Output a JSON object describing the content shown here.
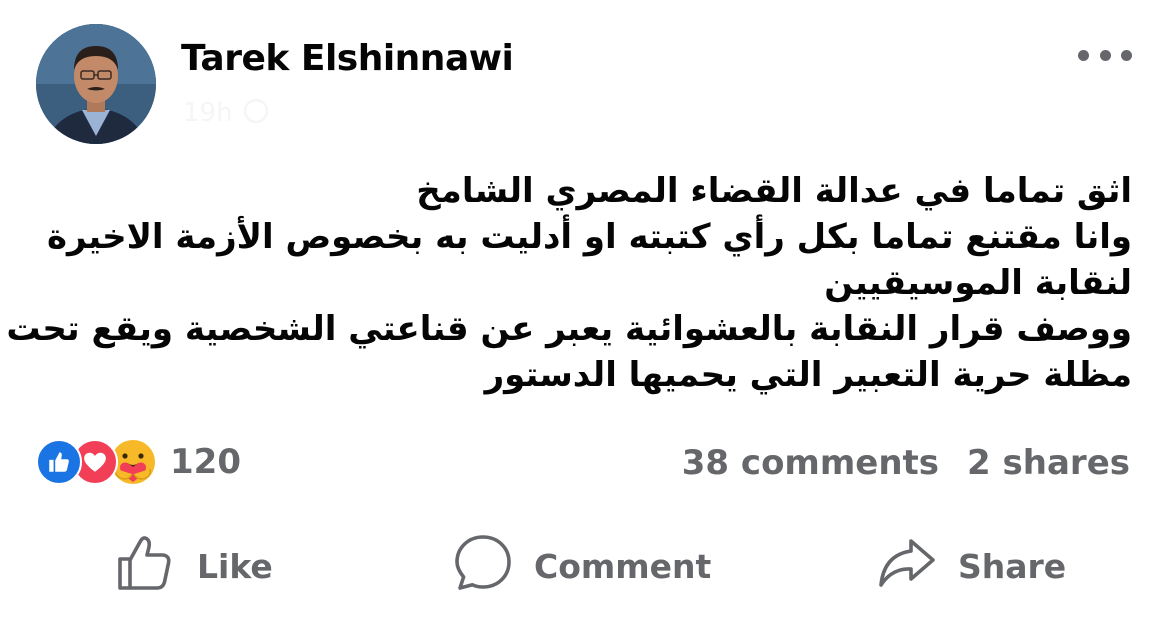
{
  "post": {
    "author": "Tarek Elshinnawi",
    "time": "19h",
    "text_lines": [
      "اثق  تماما في عدالة القضاء المصري الشامخ",
      "وانا مقتنع تماما بكل رأي كتبته او أدليت به بخصوص الأزمة الاخيرة",
      "لنقابة الموسيقيين",
      "ووصف قرار النقابة بالعشوائية يعبر عن قناعتي الشخصية ويقع تحت",
      "مظلة حرية التعبير  التي يحميها  الدستور"
    ]
  },
  "reactions": {
    "types": [
      "like-icon",
      "love-icon",
      "care-icon"
    ],
    "count": "120"
  },
  "engagement": {
    "comments": "38 comments",
    "shares": "2 shares"
  },
  "actions": {
    "like": "Like",
    "comment": "Comment",
    "share": "Share"
  },
  "colors": {
    "text": "#050505",
    "secondary": "#65676b",
    "like_blue": "#1b74e4",
    "love_red": "#f33e58",
    "care_yellow": "#f7b928"
  }
}
